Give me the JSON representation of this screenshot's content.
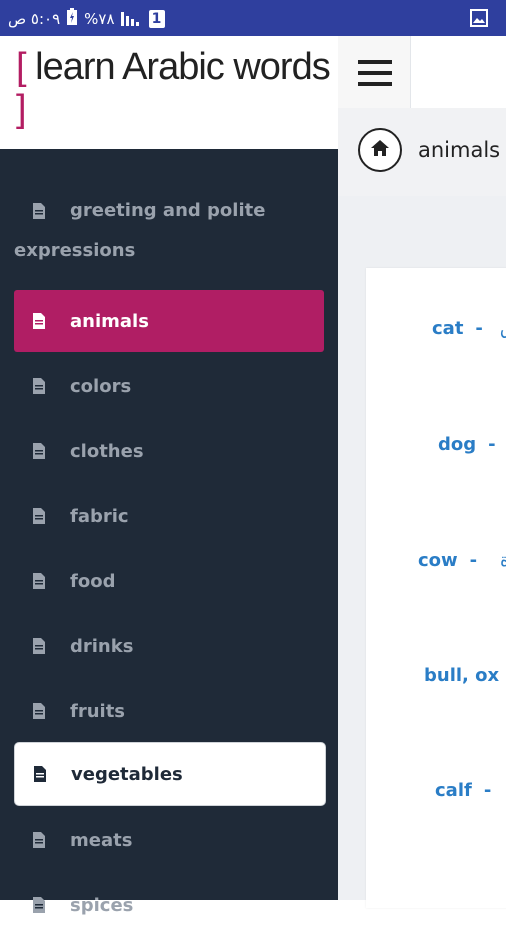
{
  "status_bar": {
    "time": "٥:٠٩ ص",
    "battery": "%٧٨",
    "sim_badge": "1"
  },
  "brand": {
    "open_bracket": "[",
    "title": "learn Arabic words",
    "close_bracket": "]"
  },
  "sidebar": {
    "items": [
      {
        "label_line1": "greeting and polite",
        "label_line2": "expressions",
        "state": "normal"
      },
      {
        "label": "animals",
        "state": "active"
      },
      {
        "label": "colors",
        "state": "normal"
      },
      {
        "label": "clothes",
        "state": "normal"
      },
      {
        "label": "fabric",
        "state": "normal"
      },
      {
        "label": "food",
        "state": "normal"
      },
      {
        "label": "drinks",
        "state": "normal"
      },
      {
        "label": "fruits",
        "state": "normal"
      },
      {
        "label": "vegetables",
        "state": "selected"
      },
      {
        "label": "meats",
        "state": "normal"
      },
      {
        "label": "spices",
        "state": "normal"
      }
    ]
  },
  "breadcrumb": {
    "current": "animals"
  },
  "words": [
    {
      "english": "cat",
      "separator": "-",
      "arabic_partial": "ق"
    },
    {
      "english": "dog",
      "separator": "-",
      "arabic_partial": ""
    },
    {
      "english": "cow",
      "separator": "-",
      "arabic_partial": "ة"
    },
    {
      "english": "bull, ox",
      "separator": "",
      "arabic_partial": ""
    },
    {
      "english": "calf",
      "separator": "-",
      "arabic_partial": ""
    }
  ],
  "colors": {
    "status_bar": "#2f3f9e",
    "sidebar_bg": "#1f2a38",
    "accent": "#b01e64",
    "link": "#2a7dc6"
  }
}
